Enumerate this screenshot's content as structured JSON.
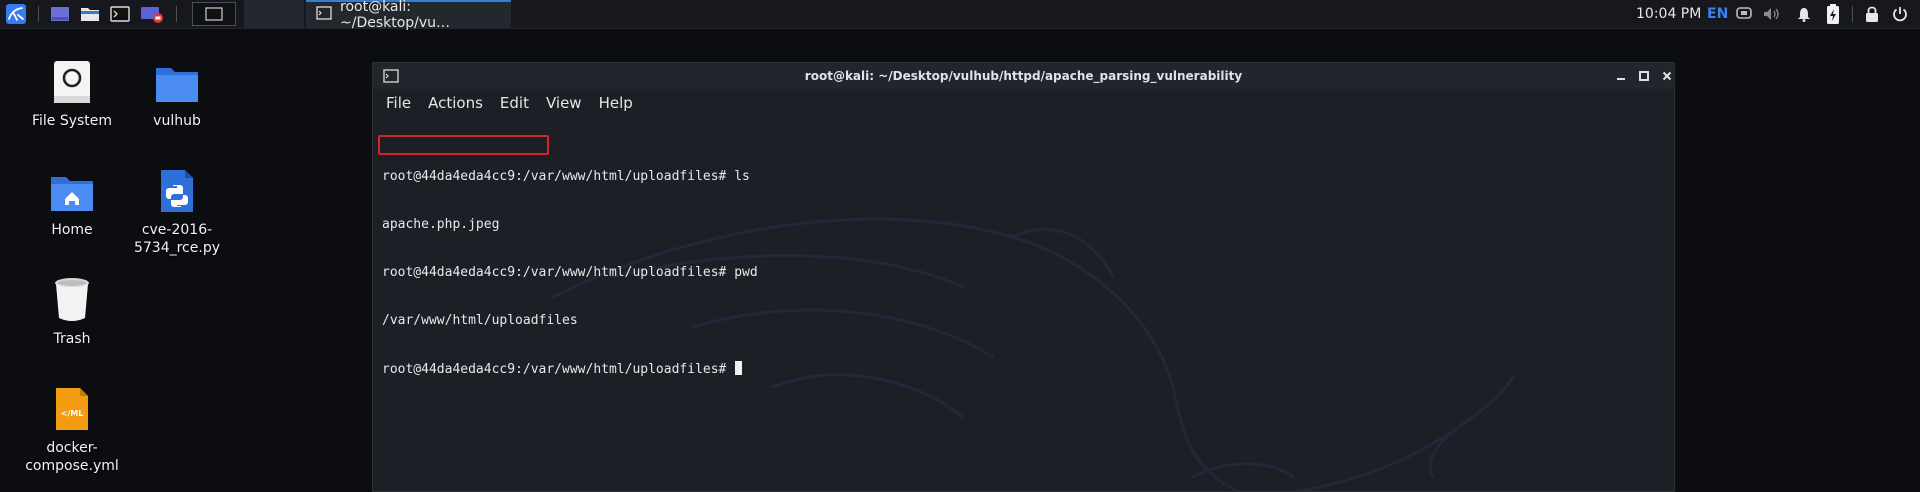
{
  "panel": {
    "active_task_title": "root@kali: ~/Desktop/vu…",
    "clock": "10:04 PM",
    "keyboard_layout": "EN",
    "colors": {
      "accent": "#2f7fd6",
      "kali_blue": "#367bf0",
      "power_red": "#c0392b"
    }
  },
  "desktop": {
    "icons": [
      {
        "label": "File System",
        "icon": "hard-drive-icon"
      },
      {
        "label": "vulhub",
        "icon": "folder-icon"
      },
      {
        "label": "Home",
        "icon": "home-folder-icon"
      },
      {
        "label": "cve-2016-5734_rce.py",
        "icon": "python-file-icon"
      },
      {
        "label": "Trash",
        "icon": "trash-icon"
      },
      {
        "label": "docker-compose.yml",
        "icon": "yml-file-icon"
      }
    ]
  },
  "terminal": {
    "title": "root@kali: ~/Desktop/vulhub/httpd/apache_parsing_vulnerability",
    "menu": [
      "File",
      "Actions",
      "Edit",
      "View",
      "Help"
    ],
    "lines": [
      "root@44da4eda4cc9:/var/www/html/uploadfiles# ls",
      "apache.php.jpeg",
      "root@44da4eda4cc9:/var/www/html/uploadfiles# pwd",
      "/var/www/html/uploadfiles",
      "root@44da4eda4cc9:/var/www/html/uploadfiles# "
    ],
    "highlight_color": "#d6262a"
  }
}
